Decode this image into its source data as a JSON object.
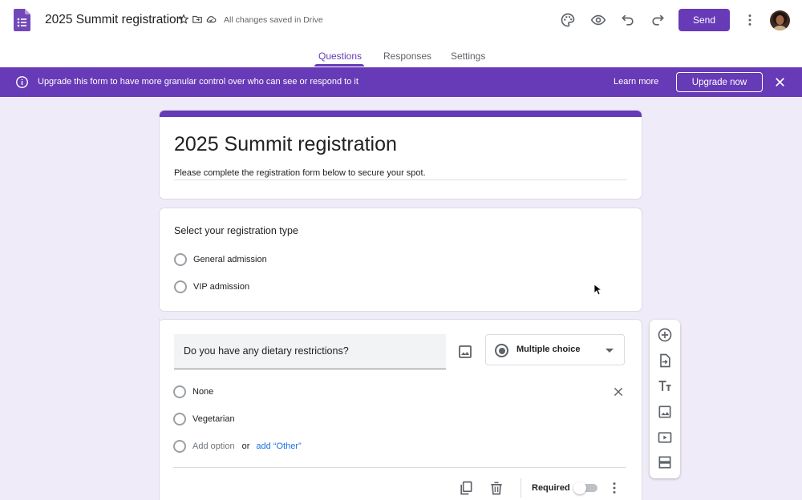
{
  "app": {
    "doc_title": "2025 Summit registration",
    "saved_status": "All changes saved in Drive",
    "send_label": "Send",
    "accent_color": "#673ab7"
  },
  "icons": {
    "forms_logo": "google-forms-icon",
    "star": "star-icon",
    "move": "folder-move-icon",
    "cloud": "cloud-saved-icon",
    "palette": "palette-icon",
    "preview": "eye-icon",
    "undo": "undo-icon",
    "redo": "redo-icon",
    "more": "more-vert-icon"
  },
  "tabs": [
    {
      "label": "Questions",
      "active": true
    },
    {
      "label": "Responses",
      "active": false
    },
    {
      "label": "Settings",
      "active": false
    }
  ],
  "banner": {
    "text": "Upgrade this form to have more granular control over who can see or respond to it",
    "learn_more": "Learn more",
    "upgrade_label": "Upgrade now"
  },
  "form": {
    "title": "2025 Summit registration",
    "description": "Please complete the registration form below to secure your spot."
  },
  "question1": {
    "title": "Select your registration type",
    "options": [
      "General admission",
      "VIP admission"
    ]
  },
  "question2": {
    "title": "Do you have any dietary restrictions?",
    "type": "Multiple choice",
    "options": [
      "None",
      "Vegetarian"
    ],
    "add_option": "Add option",
    "or": "or",
    "add_other": "add “Other”",
    "required_label": "Required",
    "required": false
  },
  "toolbar": {
    "items": [
      "add-question-icon",
      "import-questions-icon",
      "add-title-icon",
      "add-image-icon",
      "add-video-icon",
      "add-section-icon"
    ]
  }
}
